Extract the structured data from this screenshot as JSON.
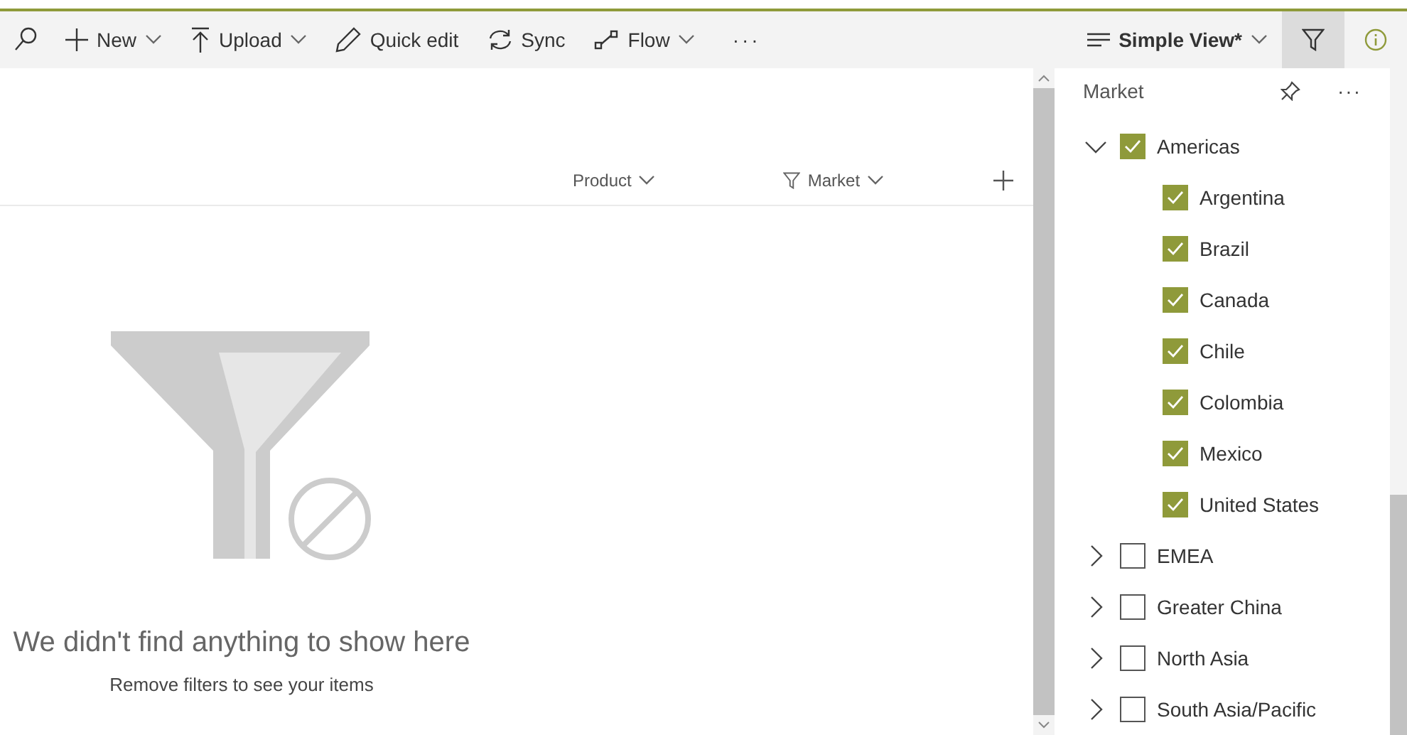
{
  "toolbar": {
    "commands": [
      {
        "kind": "search"
      },
      {
        "kind": "new",
        "label": "New",
        "dropdown": true
      },
      {
        "kind": "upload",
        "label": "Upload",
        "dropdown": true
      },
      {
        "kind": "edit",
        "label": "Quick edit",
        "dropdown": false
      },
      {
        "kind": "sync",
        "label": "Sync",
        "dropdown": false
      },
      {
        "kind": "flow",
        "label": "Flow",
        "dropdown": true
      },
      {
        "kind": "more",
        "label": "···"
      }
    ],
    "view": {
      "label": "Simple View*"
    },
    "filter_button": {
      "selected": true
    }
  },
  "list": {
    "columns": [
      {
        "label": "Product",
        "filtered": false
      },
      {
        "label": "Market",
        "filtered": true
      }
    ],
    "empty_title": "We didn't find anything to show here",
    "empty_hint": "Remove filters to see your items"
  },
  "filter_pane": {
    "title": "Market",
    "more": "···",
    "items": [
      {
        "label": "Americas",
        "checked": true,
        "expanded": true,
        "children": [
          {
            "label": "Argentina",
            "checked": true
          },
          {
            "label": "Brazil",
            "checked": true
          },
          {
            "label": "Canada",
            "checked": true
          },
          {
            "label": "Chile",
            "checked": true
          },
          {
            "label": "Colombia",
            "checked": true
          },
          {
            "label": "Mexico",
            "checked": true
          },
          {
            "label": "United States",
            "checked": true
          }
        ]
      },
      {
        "label": "EMEA",
        "checked": false,
        "expanded": false
      },
      {
        "label": "Greater China",
        "checked": false,
        "expanded": false
      },
      {
        "label": "North Asia",
        "checked": false,
        "expanded": false
      },
      {
        "label": "South Asia/Pacific",
        "checked": false,
        "expanded": false
      }
    ]
  }
}
